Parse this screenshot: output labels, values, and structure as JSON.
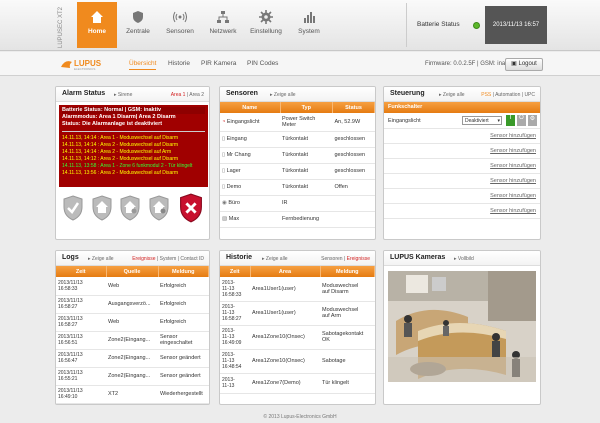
{
  "brand": {
    "label": "LUPUSEC\nXT2"
  },
  "nav": {
    "home": "Home",
    "items": [
      "Zentrale",
      "Sensoren",
      "Netzwerk",
      "Einstellung",
      "System"
    ]
  },
  "status": {
    "battery_label": "Batterie Status",
    "datetime": "2013/11/13 16:57"
  },
  "subnav": {
    "tabs": [
      "Übersicht",
      "Historie",
      "PIR Kamera",
      "PIN Codes"
    ],
    "firmware": "Firmware: 0.0.2.5F | GSM: inaktiv",
    "logout": "Logout"
  },
  "alarm": {
    "title": "Alarm Status",
    "link": "Sirene",
    "area1": "Area 1",
    "area2": "Area 2",
    "line1": "Batterie Status: Normal | GSM: inaktiv",
    "line2": "Alarmmodus: Area 1 Disarm| Area 2 Disarm",
    "line3": "Status: Die Alarmanlage ist deaktiviert",
    "events": [
      "14.11.13, 14:14 : Area 1 - Moduswechsel auf Disarm",
      "14.11.13, 14:14 : Area 2 - Moduswechsel auf Disarm",
      "14.11.13, 14:14 : Area 2 - Moduswechsel auf Arm",
      "14.11.13, 14:12 : Area 2 - Moduswechsel auf Disarm",
      "14.11.13, 13:58 : Area 1 - Zone 6 funkmodul 2 - Tür klingelt",
      "14.11.13, 13:56 : Area 2 - Moduswechsel auf Disarm"
    ]
  },
  "sensoren": {
    "title": "Sensoren",
    "link": "Zeige alle",
    "headers": [
      "Name",
      "Typ",
      "Status"
    ],
    "rows": [
      [
        "Eingangslicht",
        "Power Switch Meter",
        "An, 52.9W"
      ],
      [
        "Eingang",
        "Türkontakt",
        "geschlossen"
      ],
      [
        "Mr Chang",
        "Türkontakt",
        "geschlossen"
      ],
      [
        "Lager",
        "Türkontakt",
        "geschlossen"
      ],
      [
        "Demo",
        "Türkontakt",
        "Offen"
      ],
      [
        "Büro",
        "IR",
        ""
      ],
      [
        "Max",
        "Fernbedienung",
        ""
      ]
    ]
  },
  "steuerung": {
    "title": "Steuerung",
    "link": "Zeige alle",
    "tabs": [
      "PSS",
      "Automation",
      "UPC"
    ],
    "header": "Funkschalter",
    "switch_name": "Eingangslicht",
    "select_value": "Deaktiviert",
    "add_links": [
      "Sensor hinzufügen",
      "Sensor hinzufügen",
      "Sensor hinzufügen",
      "Sensor hinzufügen",
      "Sensor hinzufügen",
      "Sensor hinzufügen"
    ]
  },
  "logs": {
    "title": "Logs",
    "link": "Zeige alle",
    "tabs": [
      "Ereignisse",
      "System",
      "Contact ID"
    ],
    "headers": [
      "Zeit",
      "Quelle",
      "Meldung"
    ],
    "rows": [
      [
        "2013/11/13\n16:58:33",
        "Web",
        "Erfolgreich"
      ],
      [
        "2013/11/13\n16:58:27",
        "Ausgangsverzö...",
        "Erfolgreich"
      ],
      [
        "2013/11/13\n16:58:27",
        "Web",
        "Erfolgreich"
      ],
      [
        "2013/11/13\n16:56:51",
        "Zone2(Eingang...",
        "Sensor eingeschaltet"
      ],
      [
        "2013/11/13\n16:56:47",
        "Zone2(Eingang...",
        "Sensor geändert"
      ],
      [
        "2013/11/13\n16:55:21",
        "Zone2(Eingang...",
        "Sensor geändert"
      ],
      [
        "2013/11/13\n16:49:10",
        "XT2",
        "Wiederhergestellt"
      ]
    ]
  },
  "historie": {
    "title": "Historie",
    "link": "Zeige alle",
    "tabs": [
      "Sensoren",
      "Ereignisse"
    ],
    "headers": [
      "Zeit",
      "Area",
      "Meldung"
    ],
    "rows": [
      [
        "2013-\n11-13\n16:58:33",
        "Area1User1(user)",
        "Moduswechsel\nauf Disarm"
      ],
      [
        "2013-\n11-13\n16:58:27",
        "Area1User1(user)",
        "Moduswechsel\nauf Arm"
      ],
      [
        "2013-\n11-13\n16:49:09",
        "Area1Zone10(Onsec)",
        "Sabotagekontakt\nOK"
      ],
      [
        "2013-\n11-13\n16:48:54",
        "Area1Zone10(Onsec)",
        "Sabotage"
      ],
      [
        "2013-\n11-13",
        "Area1Zone7(Demo)",
        "Tür klingelt"
      ]
    ]
  },
  "kameras": {
    "title": "LUPUS Kameras",
    "link": "Vollbild"
  },
  "footer": "© 2013 Lupus-Electronics GmbH"
}
